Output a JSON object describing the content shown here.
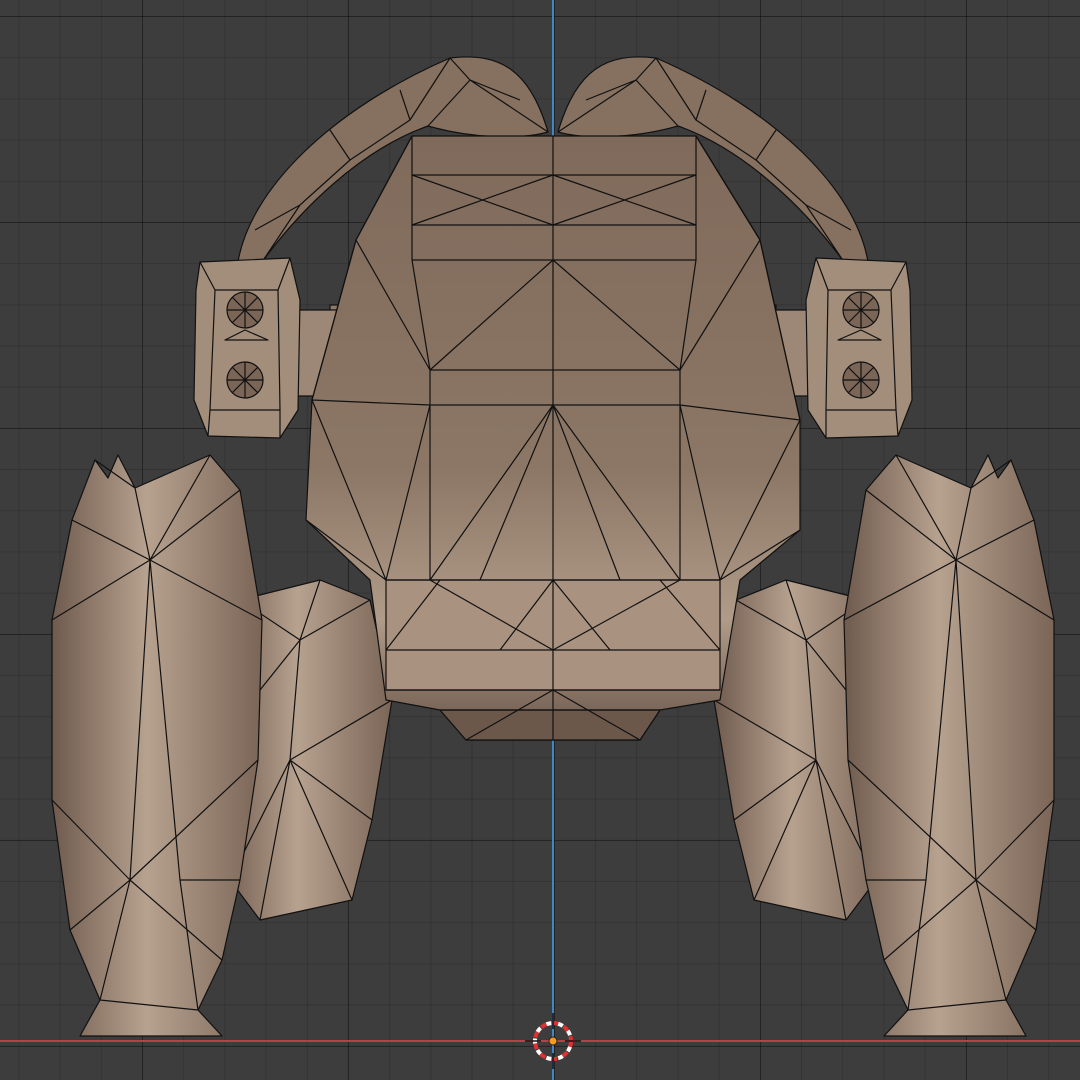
{
  "viewport": {
    "background": "#3d3d3d",
    "axis_x_color": "#b5424b",
    "axis_z_color": "#3f88c5",
    "mesh_color": "#8a7565",
    "mesh_highlight": "#b8a291",
    "mesh_shadow": "#5f4c40",
    "wire_color": "#111111"
  },
  "cursor": {
    "icon": "3d-cursor-icon",
    "ring_colors": [
      "#ffffff",
      "#e03030"
    ]
  },
  "object": {
    "icon": "object-origin-icon",
    "color": "#ff9a1a"
  }
}
